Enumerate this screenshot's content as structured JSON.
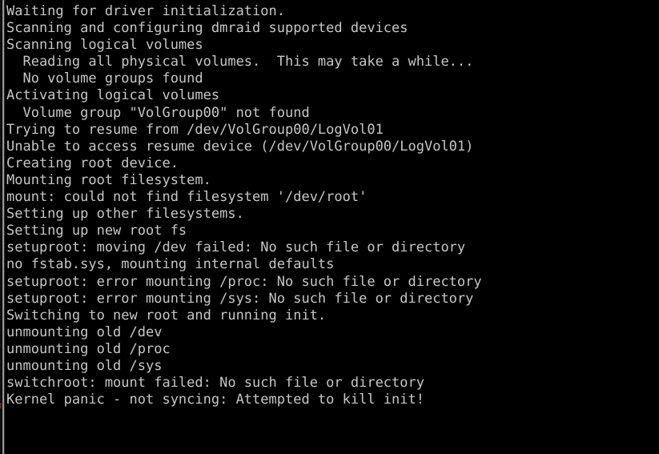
{
  "screen": {
    "kind": "linux-boot-console",
    "background_color": "#000000",
    "text_color": "#c6c6c6",
    "edge_rule_color": "#9a9a9a",
    "columns": 64,
    "rows": 26
  },
  "console": {
    "lines": [
      "Waiting for driver initialization.",
      "Scanning and configuring dmraid supported devices",
      "Scanning logical volumes",
      "  Reading all physical volumes.  This may take a while...",
      "  No volume groups found",
      "Activating logical volumes",
      "  Volume group \"VolGroup00\" not found",
      "Trying to resume from /dev/VolGroup00/LogVol01",
      "Unable to access resume device (/dev/VolGroup00/LogVol01)",
      "Creating root device.",
      "Mounting root filesystem.",
      "mount: could not find filesystem '/dev/root'",
      "Setting up other filesystems.",
      "Setting up new root fs",
      "setuproot: moving /dev failed: No such file or directory",
      "no fstab.sys, mounting internal defaults",
      "setuproot: error mounting /proc: No such file or directory",
      "setuproot: error mounting /sys: No such file or directory",
      "Switching to new root and running init.",
      "unmounting old /dev",
      "unmounting old /proc",
      "unmounting old /sys",
      "switchroot: mount failed: No such file or directory",
      "Kernel panic - not syncing: Attempted to kill init!"
    ]
  }
}
